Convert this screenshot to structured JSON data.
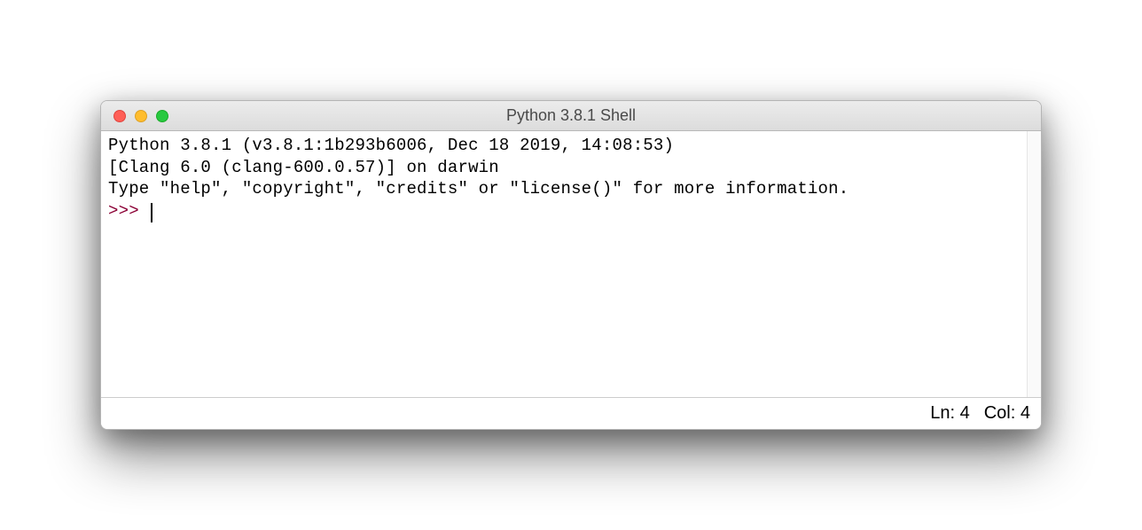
{
  "window": {
    "title": "Python 3.8.1 Shell"
  },
  "shell": {
    "line1": "Python 3.8.1 (v3.8.1:1b293b6006, Dec 18 2019, 14:08:53)",
    "line2": "[Clang 6.0 (clang-600.0.57)] on darwin",
    "line3": "Type \"help\", \"copyright\", \"credits\" or \"license()\" for more information.",
    "prompt": ">>> "
  },
  "status": {
    "ln_label": "Ln:",
    "ln_value": "4",
    "col_label": "Col:",
    "col_value": "4"
  }
}
